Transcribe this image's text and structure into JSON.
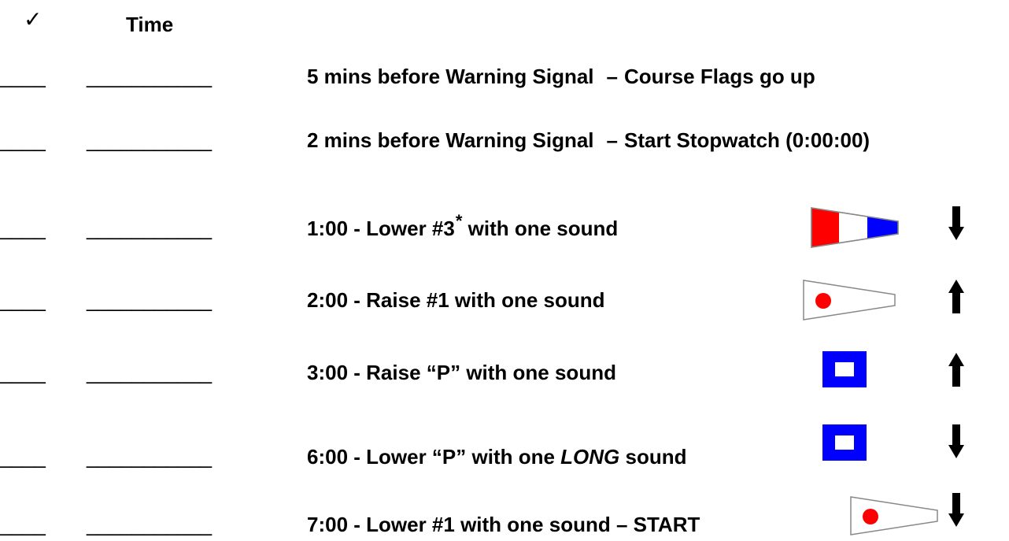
{
  "header": {
    "check_glyph": "✓",
    "time_label": "Time"
  },
  "blank_short": "____",
  "blank_long": "___________",
  "rows": [
    {
      "pre": "5 mins before Warning Signal",
      "sep": "–",
      "post": "Course Flags go up"
    },
    {
      "pre": "2 mins before Warning Signal",
      "sep": "–",
      "post": "Start Stopwatch (0:00:00)"
    },
    {
      "pre": "1:00 - Lower #3",
      "asterisk": "*",
      "post": " with one sound",
      "flag": "pennant-3",
      "arrow": "down"
    },
    {
      "pre": "2:00 - Raise #1 with one sound",
      "flag": "pennant-1",
      "arrow": "up"
    },
    {
      "pre": "3:00 - Raise “P” with one sound",
      "flag": "flag-p",
      "arrow": "up"
    },
    {
      "pre": "6:00 - Lower “P” with one ",
      "em": "LONG",
      "post": " sound",
      "flag": "flag-p",
      "arrow": "down"
    },
    {
      "pre": "7:00 - Lower #1 with one sound – START",
      "flag": "pennant-1",
      "arrow": "down"
    }
  ],
  "colors": {
    "red": "#ff0000",
    "blue": "#0000ff",
    "black": "#000000"
  }
}
